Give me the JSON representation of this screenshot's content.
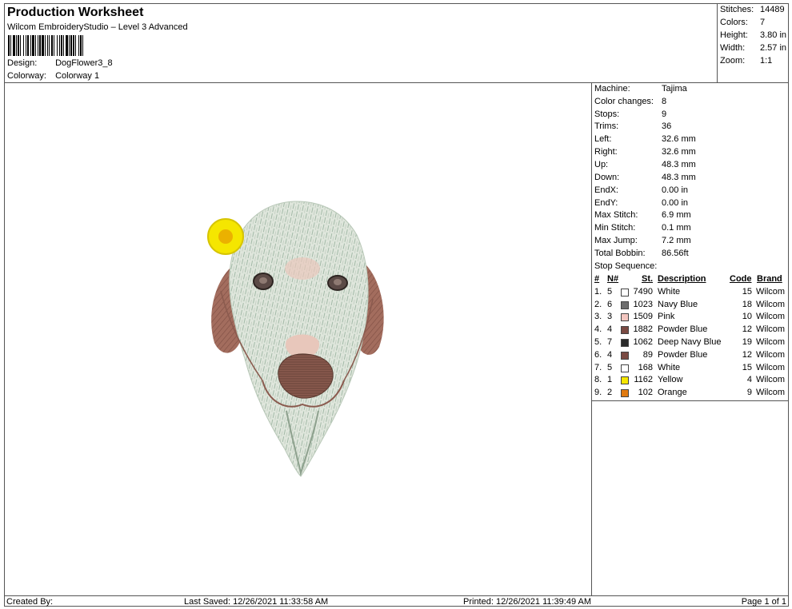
{
  "header": {
    "title": "Production Worksheet",
    "subtitle": "Wilcom EmbroideryStudio – Level 3 Advanced",
    "design_label": "Design:",
    "design_value": "DogFlower3_8",
    "colorway_label": "Colorway:",
    "colorway_value": "Colorway 1"
  },
  "stats": [
    {
      "label": "Stitches:",
      "value": "14489"
    },
    {
      "label": "Colors:",
      "value": "7"
    },
    {
      "label": "Height:",
      "value": "3.80 in"
    },
    {
      "label": "Width:",
      "value": "2.57 in"
    },
    {
      "label": "Zoom:",
      "value": "1:1"
    }
  ],
  "properties": [
    {
      "label": "Machine:",
      "value": "Tajima"
    },
    {
      "label": "Color changes:",
      "value": "8"
    },
    {
      "label": "Stops:",
      "value": "9"
    },
    {
      "label": "Trims:",
      "value": "36"
    },
    {
      "label": "Left:",
      "value": "32.6 mm"
    },
    {
      "label": "Right:",
      "value": "32.6 mm"
    },
    {
      "label": "Up:",
      "value": "48.3 mm"
    },
    {
      "label": "Down:",
      "value": "48.3 mm"
    },
    {
      "label": "EndX:",
      "value": "0.00 in"
    },
    {
      "label": "EndY:",
      "value": "0.00 in"
    },
    {
      "label": "Max Stitch:",
      "value": "6.9 mm"
    },
    {
      "label": "Min Stitch:",
      "value": "0.1 mm"
    },
    {
      "label": "Max Jump:",
      "value": "7.2 mm"
    },
    {
      "label": "Total Bobbin:",
      "value": "86.56ft"
    }
  ],
  "stop_sequence": {
    "heading": "Stop Sequence:",
    "columns": {
      "num": "#",
      "n": "N#",
      "st": "St.",
      "description": "Description",
      "code": "Code",
      "brand": "Brand"
    },
    "rows": [
      {
        "num": "1.",
        "n": "5",
        "color": "#ffffff",
        "st": "7490",
        "description": "White",
        "code": "15",
        "brand": "Wilcom"
      },
      {
        "num": "2.",
        "n": "6",
        "color": "#6e6e6e",
        "st": "1023",
        "description": "Navy Blue",
        "code": "18",
        "brand": "Wilcom"
      },
      {
        "num": "3.",
        "n": "3",
        "color": "#f3c6c0",
        "st": "1509",
        "description": "Pink",
        "code": "10",
        "brand": "Wilcom"
      },
      {
        "num": "4.",
        "n": "4",
        "color": "#7a4a42",
        "st": "1882",
        "description": "Powder Blue",
        "code": "12",
        "brand": "Wilcom"
      },
      {
        "num": "5.",
        "n": "7",
        "color": "#2b2b2b",
        "st": "1062",
        "description": "Deep Navy Blue",
        "code": "19",
        "brand": "Wilcom"
      },
      {
        "num": "6.",
        "n": "4",
        "color": "#7a4a42",
        "st": "89",
        "description": "Powder Blue",
        "code": "12",
        "brand": "Wilcom"
      },
      {
        "num": "7.",
        "n": "5",
        "color": "#ffffff",
        "st": "168",
        "description": "White",
        "code": "15",
        "brand": "Wilcom"
      },
      {
        "num": "8.",
        "n": "1",
        "color": "#f5e600",
        "st": "1162",
        "description": "Yellow",
        "code": "4",
        "brand": "Wilcom"
      },
      {
        "num": "9.",
        "n": "2",
        "color": "#e07a10",
        "st": "102",
        "description": "Orange",
        "code": "9",
        "brand": "Wilcom"
      }
    ]
  },
  "footer": {
    "created_by": "Created By:",
    "last_saved": "Last Saved: 12/26/2021 11:33:58 AM",
    "printed": "Printed: 12/26/2021 11:39:49 AM",
    "page": "Page 1 of 1"
  }
}
